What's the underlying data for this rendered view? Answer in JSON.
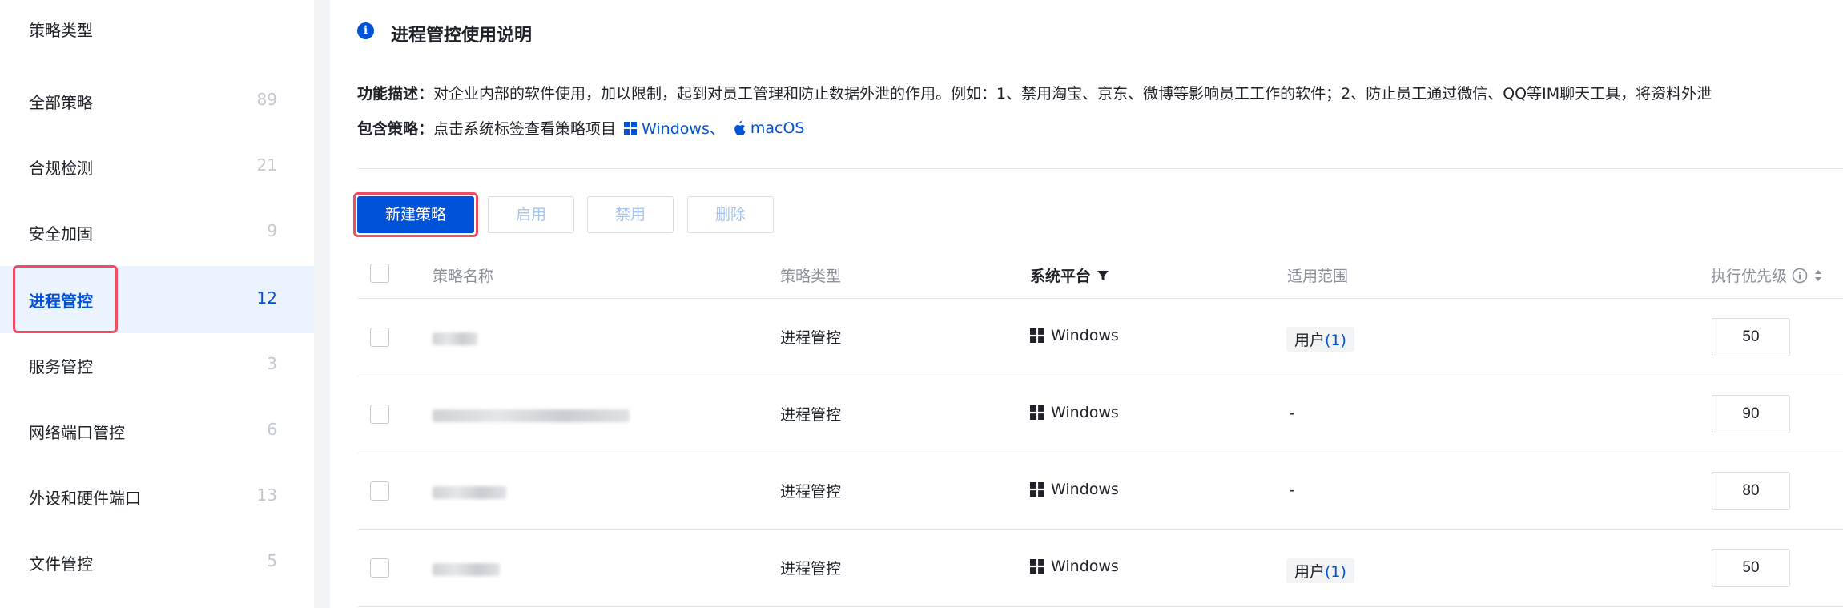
{
  "sidebar": {
    "title": "策略类型",
    "items": [
      {
        "label": "全部策略",
        "count": "89"
      },
      {
        "label": "合规检测",
        "count": "21"
      },
      {
        "label": "安全加固",
        "count": "9"
      },
      {
        "label": "进程管控",
        "count": "12"
      },
      {
        "label": "服务管控",
        "count": "3"
      },
      {
        "label": "网络端口管控",
        "count": "6"
      },
      {
        "label": "外设和硬件端口",
        "count": "13"
      },
      {
        "label": "文件管控",
        "count": "5"
      }
    ]
  },
  "info": {
    "icon": "info-icon",
    "title": "进程管控使用说明",
    "desc_label": "功能描述：",
    "desc_text": "对企业内部的软件使用，加以限制，起到对员工管理和防止数据外泄的作用。例如：1、禁用淘宝、京东、微博等影响员工工作的软件；2、防止员工通过微信、QQ等IM聊天工具，将资料外泄",
    "policies_label": "包含策略：",
    "policies_text": "点击系统标签查看策略项目",
    "windows_link": "Windows、",
    "macos_link": "macOS"
  },
  "toolbar": {
    "new_label": "新建策略",
    "enable_label": "启用",
    "disable_label": "禁用",
    "delete_label": "删除"
  },
  "table": {
    "headers": {
      "name": "策略名称",
      "type": "策略类型",
      "platform": "系统平台",
      "scope": "适用范围",
      "priority": "执行优先级"
    },
    "rows": [
      {
        "type": "进程管控",
        "platform": "Windows",
        "scope_label": "用户",
        "scope_count": "(1)",
        "scope": "",
        "priority": "50"
      },
      {
        "type": "进程管控",
        "platform": "Windows",
        "scope_label": "",
        "scope_count": "",
        "scope": "-",
        "priority": "90"
      },
      {
        "type": "进程管控",
        "platform": "Windows",
        "scope_label": "",
        "scope_count": "",
        "scope": "-",
        "priority": "80"
      },
      {
        "type": "进程管控",
        "platform": "Windows",
        "scope_label": "用户",
        "scope_count": "(1)",
        "scope": "",
        "priority": "50"
      }
    ]
  },
  "colors": {
    "accent": "#0052d9",
    "highlight": "#f04d63",
    "active_bg": "#ebf3ff"
  }
}
